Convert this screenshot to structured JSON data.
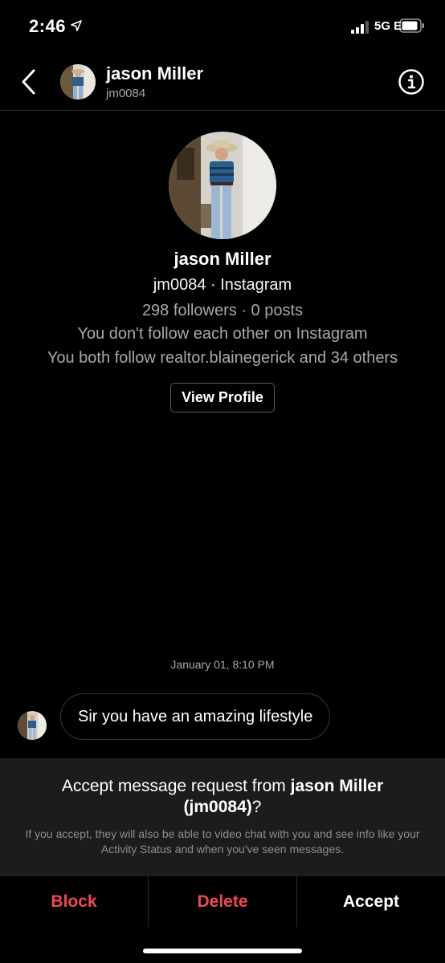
{
  "status_bar": {
    "time": "2:46",
    "network": "5G E",
    "icons": [
      "location-arrow-icon",
      "signal-bars-icon",
      "battery-icon"
    ]
  },
  "header": {
    "name": "jason Miller",
    "handle": "jm0084",
    "icons": [
      "chevron-left-icon",
      "info-icon"
    ]
  },
  "profile": {
    "name": "jason Miller",
    "handle_line": "jm0084 · Instagram",
    "stats": "298 followers · 0 posts",
    "follow_status": "You don't follow each other on Instagram",
    "mutual": "You both follow realtor.blainegerick and 34 others",
    "view_profile_label": "View Profile"
  },
  "conversation": {
    "timestamp": "January 01, 8:10 PM",
    "messages": [
      {
        "text": "Sir you have an amazing lifestyle"
      }
    ]
  },
  "request": {
    "title_prefix": "Accept message request from ",
    "title_name": "jason Miller",
    "title_handle": "(jm0084)",
    "title_suffix": "?",
    "description": "If you accept, they will also be able to video chat with you and see info like your Activity Status and when you've seen messages."
  },
  "actions": {
    "block": "Block",
    "delete": "Delete",
    "accept": "Accept"
  },
  "colors": {
    "background": "#000000",
    "danger": "#ed4956",
    "panel": "#1c1c1c",
    "secondary_text": "#a8a8a8"
  }
}
